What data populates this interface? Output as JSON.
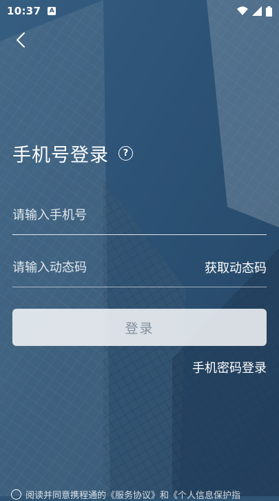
{
  "status_bar": {
    "time": "10:37",
    "badge": "A",
    "icons": [
      "wifi-icon",
      "signal-icon",
      "battery-icon"
    ]
  },
  "header": {
    "back_icon": "chevron-left-icon",
    "title": "手机号登录",
    "help_symbol": "?"
  },
  "form": {
    "phone_placeholder": "请输入手机号",
    "code_placeholder": "请输入动态码",
    "get_code_label": "获取动态码",
    "login_label": "登录",
    "password_login_label": "手机密码登录"
  },
  "footer": {
    "agreement_text": "阅读并同意携程通的《服务协议》和《个人信息保护指"
  },
  "colors": {
    "background": "#2f5373",
    "text": "#ffffff",
    "button_bg": "rgba(255,255,255,0.82)"
  }
}
